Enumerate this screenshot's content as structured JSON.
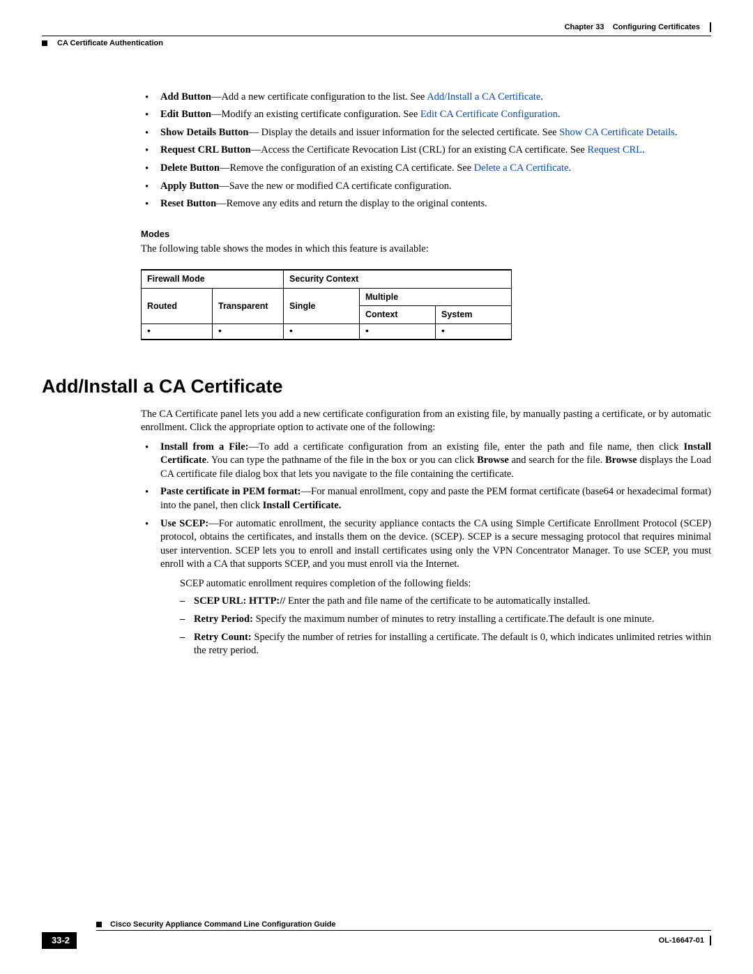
{
  "header": {
    "chapter_label": "Chapter 33",
    "chapter_title": "Configuring Certificates",
    "section_label": "CA Certificate Authentication"
  },
  "bullets_top": [
    {
      "bold": "Add Button",
      "text": "—Add a new certificate configuration to the list. See ",
      "link": "Add/Install a CA Certificate",
      "tail": "."
    },
    {
      "bold": "Edit Button",
      "text": "—Modify an existing certificate configuration. See ",
      "link": "Edit CA Certificate Configuration",
      "tail": "."
    },
    {
      "bold": "Show Details Button",
      "text": "— Display the details and issuer information for the selected certificate. See ",
      "link": "Show CA Certificate Details",
      "tail": "."
    },
    {
      "bold": "Request CRL Button",
      "text": "—Access the Certificate Revocation List (CRL) for an existing CA certificate. See ",
      "link": "Request CRL",
      "tail": "."
    },
    {
      "bold": "Delete Button",
      "text": "—Remove the configuration of an existing CA certificate. See ",
      "link": "Delete a CA Certificate",
      "tail": "."
    },
    {
      "bold": "Apply Button",
      "text": "—Save the new or modified CA certificate configuration.",
      "link": "",
      "tail": ""
    },
    {
      "bold": "Reset Button",
      "text": "—Remove any edits and return the display to the original contents.",
      "link": "",
      "tail": ""
    }
  ],
  "modes": {
    "heading": "Modes",
    "intro": "The following table shows the modes in which this feature is available:",
    "headers": {
      "firewall": "Firewall Mode",
      "security": "Security Context",
      "multiple": "Multiple",
      "routed": "Routed",
      "transparent": "Transparent",
      "single": "Single",
      "context": "Context",
      "system": "System"
    }
  },
  "title2": "Add/Install a CA Certificate",
  "intro2": "The CA Certificate panel lets you add a new certificate configuration from an existing file, by manually pasting a certificate, or by automatic enrollment. Click the appropriate option to activate one of the following:",
  "bullets2": {
    "b1": {
      "lead": "Install from a File:",
      "rest": "—To add a certificate configuration from an existing file, enter the path and file name, then click ",
      "bold2": "Install Certificate",
      "rest2": ". You can type the pathname of the file in the box or you can click ",
      "bold3": "Browse",
      "rest3": " and search for the file. ",
      "bold4": "Browse",
      "rest4": " displays the Load CA certificate file dialog box that lets you navigate to the file containing the certificate."
    },
    "b2": {
      "lead": "Paste certificate in PEM format:",
      "rest": "—For manual enrollment, copy and paste the PEM format certificate (base64 or hexadecimal format) into the panel, then click ",
      "bold2": "Install Certificate."
    },
    "b3": {
      "lead": "Use SCEP:",
      "rest": "—For automatic enrollment, the security appliance contacts the CA using Simple Certificate Enrollment Protocol (SCEP) protocol, obtains the certificates, and installs them on the device. (SCEP). SCEP is a secure messaging protocol that requires minimal user intervention. SCEP lets you to enroll and install certificates using only the VPN Concentrator Manager. To use SCEP, you must enroll with a CA that supports SCEP, and you must enroll via the Internet.",
      "note": "SCEP automatic enrollment requires completion of the following fields:"
    }
  },
  "dashes": {
    "d1": {
      "lead": "SCEP URL: HTTP://",
      "rest": " Enter the path and file name of the certificate to be automatically installed."
    },
    "d2": {
      "lead": "Retry Period:",
      "rest": " Specify the maximum number of minutes to retry installing a certificate.The default is one minute."
    },
    "d3": {
      "lead": "Retry Count:",
      "rest": " Specify the number of retries for installing a certificate. The default is 0, which indicates unlimited retries within the retry period."
    }
  },
  "footer": {
    "guide_title": "Cisco Security Appliance Command Line Configuration Guide",
    "page_num": "33-2",
    "doc_id": "OL-16647-01"
  }
}
